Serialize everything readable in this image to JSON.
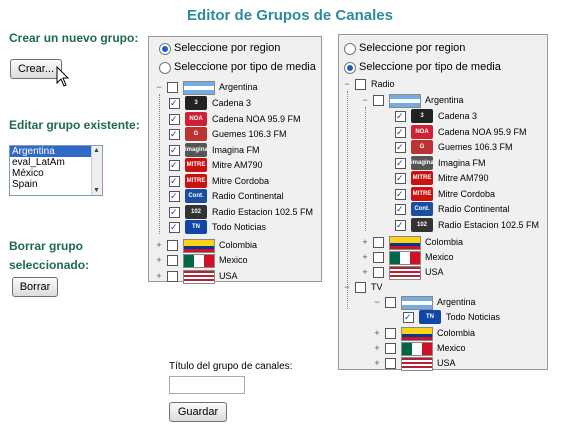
{
  "page_title": "Editor de Grupos de Canales",
  "left": {
    "create_heading": "Crear un nuevo grupo:",
    "create_button": "Crear...",
    "edit_heading": "Editar grupo existente:",
    "groups": [
      {
        "label": "Argentina",
        "selected": true
      },
      {
        "label": "eval_LatAm",
        "selected": false
      },
      {
        "label": "México",
        "selected": false
      },
      {
        "label": "Spain",
        "selected": false
      }
    ],
    "delete_heading_line1": "Borrar grupo",
    "delete_heading_line2": "seleccionado:",
    "delete_button": "Borrar"
  },
  "panel1": {
    "radio_region": "Seleccione por region",
    "radio_media": "Seleccione por tipo de media",
    "selected_mode": "region",
    "country": "Argentina",
    "channels": [
      "Cadena 3",
      "Cadena NOA 95.9 FM",
      "Guemes 106.3 FM",
      "Imagina FM",
      "Mitre AM790",
      "Mitre Cordoba",
      "Radio Continental",
      "Radio Estacion 102.5 FM",
      "Todo Noticias"
    ],
    "other_countries": [
      "Colombia",
      "Mexico",
      "USA"
    ]
  },
  "panel2": {
    "radio_region": "Seleccione por region",
    "radio_media": "Seleccione por tipo de media",
    "selected_mode": "media",
    "media_radio": "Radio",
    "radio_country": "Argentina",
    "radio_channels": [
      "Cadena 3",
      "Cadena NOA 95.9 FM",
      "Guemes 106.3 FM",
      "Imagina FM",
      "Mitre AM790",
      "Mitre Cordoba",
      "Radio Continental",
      "Radio Estacion 102.5 FM"
    ],
    "radio_other_countries": [
      "Colombia",
      "Mexico",
      "USA"
    ],
    "media_tv": "TV",
    "tv_country": "Argentina",
    "tv_channels": [
      "Todo Noticias"
    ],
    "tv_other_countries": [
      "Colombia",
      "Mexico",
      "USA"
    ]
  },
  "form": {
    "name_label": "Título del grupo de canales:",
    "name_value": "",
    "save_button": "Guardar"
  },
  "logos": {
    "Cadena 3": "3",
    "Cadena NOA 95.9 FM": "NOA",
    "Guemes 106.3 FM": "G",
    "Imagina FM": "imagina",
    "Mitre AM790": "MITRE",
    "Mitre Cordoba": "MITRE",
    "Radio Continental": "Cont.",
    "Radio Estacion 102.5 FM": "102",
    "Todo Noticias": "TN"
  },
  "colors": {
    "title": "#2e8b9b",
    "heading": "#1e6b4a",
    "panel_bg": "#f0f0f0",
    "check": "#1a3fa0"
  }
}
